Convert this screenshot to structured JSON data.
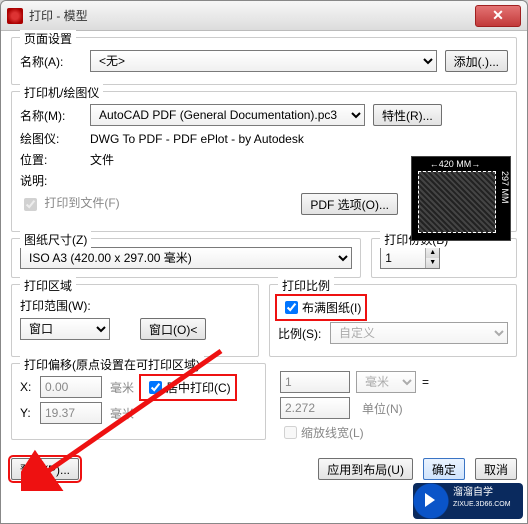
{
  "window": {
    "title": "打印 - 模型"
  },
  "page_setup": {
    "legend": "页面设置",
    "name_label": "名称(A):",
    "name_value": "<无>",
    "add_btn": "添加(.)..."
  },
  "printer": {
    "legend": "打印机/绘图仪",
    "name_label": "名称(M):",
    "name_value": "AutoCAD PDF (General Documentation).pc3",
    "props_btn": "特性(R)...",
    "plotter_label": "绘图仪:",
    "plotter_value": "DWG To PDF - PDF ePlot - by Autodesk",
    "where_label": "位置:",
    "where_value": "文件",
    "desc_label": "说明:",
    "tofile_label": "打印到文件(F)",
    "pdf_options_btn": "PDF 选项(O)...",
    "preview_top": "←420 MM→",
    "preview_right": "297 MM"
  },
  "paper": {
    "legend": "图纸尺寸(Z)",
    "value": "ISO A3 (420.00 x 297.00 毫米)"
  },
  "copies": {
    "legend": "打印份数(B)",
    "value": "1"
  },
  "area": {
    "legend": "打印区域",
    "range_label": "打印范围(W):",
    "range_value": "窗口",
    "window_btn": "窗口(O)<"
  },
  "scale": {
    "legend": "打印比例",
    "fit_label": "布满图纸(I)",
    "ratio_label": "比例(S):",
    "ratio_value": "自定义",
    "num": "1",
    "unit": "毫米",
    "eq": "=",
    "denom": "2.272",
    "unit_label": "单位(N)",
    "lineweight_label": "缩放线宽(L)"
  },
  "offset": {
    "legend": "打印偏移(原点设置在可打印区域)",
    "x_label": "X:",
    "x_value": "0.00",
    "y_label": "Y:",
    "y_value": "19.37",
    "unit": "毫米",
    "center_label": "居中打印(C)"
  },
  "footer": {
    "preview": "预览(P)...",
    "apply": "应用到布局(U)",
    "ok": "确定",
    "cancel": "取消"
  },
  "watermark": {
    "line1": "溜溜自学",
    "line2": "ZIXUE.3D66.COM"
  }
}
